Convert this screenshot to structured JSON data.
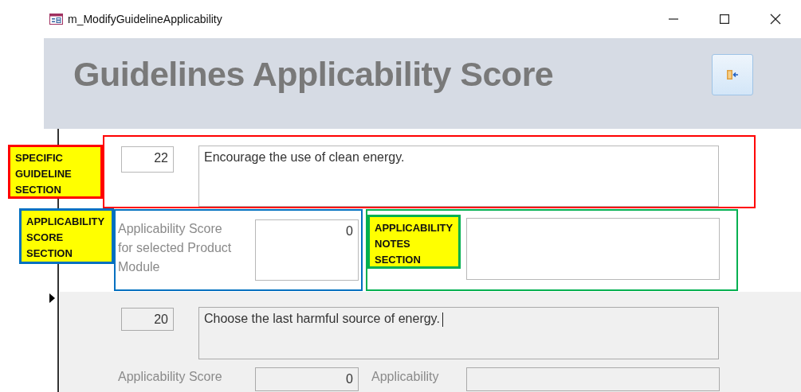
{
  "window": {
    "title": "m_ModifyGuidelineApplicability"
  },
  "header": {
    "title": "Guidelines Applicability Score"
  },
  "records": [
    {
      "current": false,
      "id": "22",
      "guideline": "Encourage the use of clean energy.",
      "caret": false,
      "score_label": "Applicability Score for selected Product Module",
      "score": "0"
    },
    {
      "current": true,
      "id": "20",
      "guideline": "Choose the last harmful source of energy.",
      "caret": true,
      "score_label": "Applicability Score",
      "score": "0",
      "notes_label": "Applicability"
    }
  ],
  "annotations": [
    {
      "label": "SPECIFIC GUIDELINE SECTION",
      "color": "#ff0000"
    },
    {
      "label": "APPLICABILITY SCORE SECTION",
      "color": "#0070c0"
    },
    {
      "label": "APPLICABILITY NOTES SECTION",
      "color": "#00b050"
    }
  ]
}
